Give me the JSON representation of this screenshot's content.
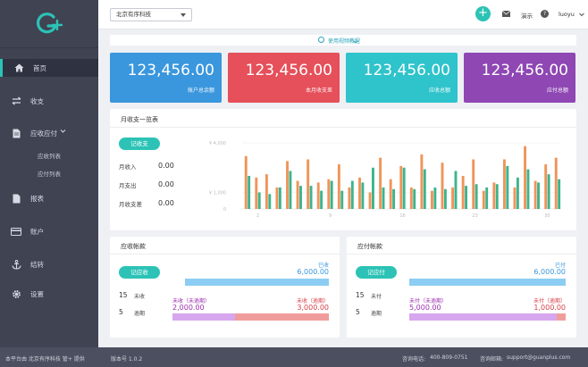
{
  "sidebar": {
    "items": [
      {
        "label": "首页",
        "icon": "home-icon"
      },
      {
        "label": "收支",
        "icon": "exchange-icon"
      },
      {
        "label": "应收应付",
        "icon": "document-icon"
      },
      {
        "label": "报表",
        "icon": "report-icon"
      },
      {
        "label": "账户",
        "icon": "credit-card-icon"
      },
      {
        "label": "结转",
        "icon": "anchor-icon"
      },
      {
        "label": "设置",
        "icon": "gear-icon"
      }
    ],
    "subitems": [
      "应收列表",
      "应付列表"
    ]
  },
  "topbar": {
    "company": "北京有序科技",
    "demo": "演示",
    "user": "luoyu"
  },
  "tutorial": "使用视频教程",
  "stats": [
    {
      "value": "123,456.00",
      "label": "账户总余额",
      "color": "#3a97dd"
    },
    {
      "value": "123,456.00",
      "label": "本月收支差",
      "color": "#e5505a"
    },
    {
      "value": "123,456.00",
      "label": "应收总额",
      "color": "#2fc3cb"
    },
    {
      "value": "123,456.00",
      "label": "应付总额",
      "color": "#8e47b3"
    }
  ],
  "monthly": {
    "title": "月收支一览表",
    "button": "记收支",
    "rows": [
      {
        "label": "月收入",
        "value": "0.00"
      },
      {
        "label": "月支出",
        "value": "0.00"
      },
      {
        "label": "月收支差",
        "value": "0.00"
      }
    ]
  },
  "chart_data": {
    "type": "bar",
    "ytick_labels": [
      "¥ 4,000",
      "¥ 1,000",
      "0"
    ],
    "xtick_labels": [
      "2",
      "9",
      "16",
      "23",
      "30"
    ],
    "categories": [
      "1",
      "2",
      "3",
      "4",
      "5",
      "6",
      "7",
      "8",
      "9",
      "10",
      "11",
      "12",
      "13",
      "14",
      "15",
      "16",
      "17",
      "18",
      "19",
      "20",
      "21",
      "22",
      "23",
      "24",
      "25",
      "26",
      "27",
      "28",
      "29",
      "30",
      "31"
    ],
    "ylim": [
      0,
      4000
    ],
    "series": [
      {
        "color": "#f0945a",
        "values": [
          3200,
          1900,
          2100,
          1300,
          2900,
          1700,
          3000,
          1600,
          1800,
          2700,
          1300,
          1900,
          1000,
          3100,
          1800,
          2600,
          1300,
          3300,
          1100,
          2800,
          1300,
          2000,
          3000,
          1100,
          1600,
          3000,
          1300,
          3800,
          1700,
          2700,
          3100
        ]
      },
      {
        "color": "#3db48d",
        "values": [
          2000,
          1000,
          900,
          1300,
          2300,
          1400,
          1400,
          1100,
          1700,
          1100,
          1700,
          1600,
          2500,
          1300,
          1200,
          2500,
          1200,
          2400,
          1300,
          1200,
          2300,
          1400,
          1500,
          1300,
          1500,
          2600,
          1900,
          2400,
          1600,
          2100,
          1800
        ]
      }
    ]
  },
  "receivable": {
    "title": "应收帐款",
    "button": "记应收",
    "done_label": "已收",
    "done_value": "6,000.00",
    "count1": "15",
    "count1_label": "未收",
    "count2": "5",
    "count2_label": "逾期",
    "left_label": "未收（未逾期）",
    "left_value": "2,000.00",
    "right_label": "未收（逾期）",
    "right_value": "3,000.00",
    "split_fraction": 0.4
  },
  "payable": {
    "title": "应付帐款",
    "button": "记应付",
    "done_label": "已付",
    "done_value": "6,000.00",
    "count1": "15",
    "count1_label": "未付",
    "count2": "5",
    "count2_label": "逾期",
    "left_label": "未付（未逾期）",
    "left_value": "5,000.00",
    "right_label": "未付（逾期）",
    "right_value": "1,000.00",
    "split_fraction": 0.94
  },
  "footer": {
    "left": "本平台由 北京有序科技 管+ 提供",
    "version": "版本号 1.0.2",
    "phone_label": "咨询电话:",
    "phone": "400-809-0751",
    "email_label": "咨询邮箱:",
    "email": "support@guanplus.com"
  }
}
